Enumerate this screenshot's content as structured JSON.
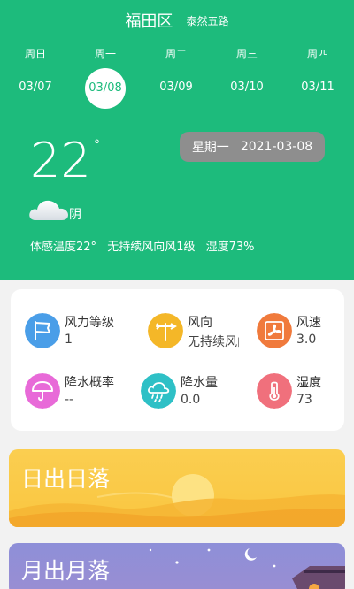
{
  "header": {
    "district": "福田区",
    "street": "泰然五路"
  },
  "days": [
    {
      "weekday": "周日",
      "date": "03/07"
    },
    {
      "weekday": "周一",
      "date": "03/08"
    },
    {
      "weekday": "周二",
      "date": "03/09"
    },
    {
      "weekday": "周三",
      "date": "03/10"
    },
    {
      "weekday": "周四",
      "date": "03/11"
    }
  ],
  "current": {
    "temperature": "22",
    "degree_symbol": "°",
    "condition": "阴",
    "weekday": "星期一",
    "date": "2021-03-08",
    "feels_like": "体感温度22°",
    "wind_desc": "无持续风向风1级",
    "humidity_desc": "湿度73%"
  },
  "details": [
    {
      "label": "风力等级",
      "value": "1",
      "icon": "wind-flag-icon",
      "color": "#4a9ee8"
    },
    {
      "label": "风向",
      "value": "无持续风向",
      "icon": "wind-vane-icon",
      "color": "#f4b728"
    },
    {
      "label": "风速",
      "value": "3.0",
      "icon": "fan-icon",
      "color": "#f07a3c"
    },
    {
      "label": "降水概率",
      "value": "--",
      "icon": "umbrella-icon",
      "color": "#e86ad8"
    },
    {
      "label": "降水量",
      "value": "0.0",
      "icon": "rain-cloud-icon",
      "color": "#2ec0c6"
    },
    {
      "label": "湿度",
      "value": "73",
      "icon": "thermometer-icon",
      "color": "#f0707c"
    }
  ],
  "sunrise_title": "日出日落",
  "moonrise_title": "月出月落",
  "colors": {
    "header_green": "#1dbb7c",
    "date_pill": "#8e8e8e",
    "sun_banner": "#fbce50",
    "moon_banner": "#8e8fd8"
  }
}
